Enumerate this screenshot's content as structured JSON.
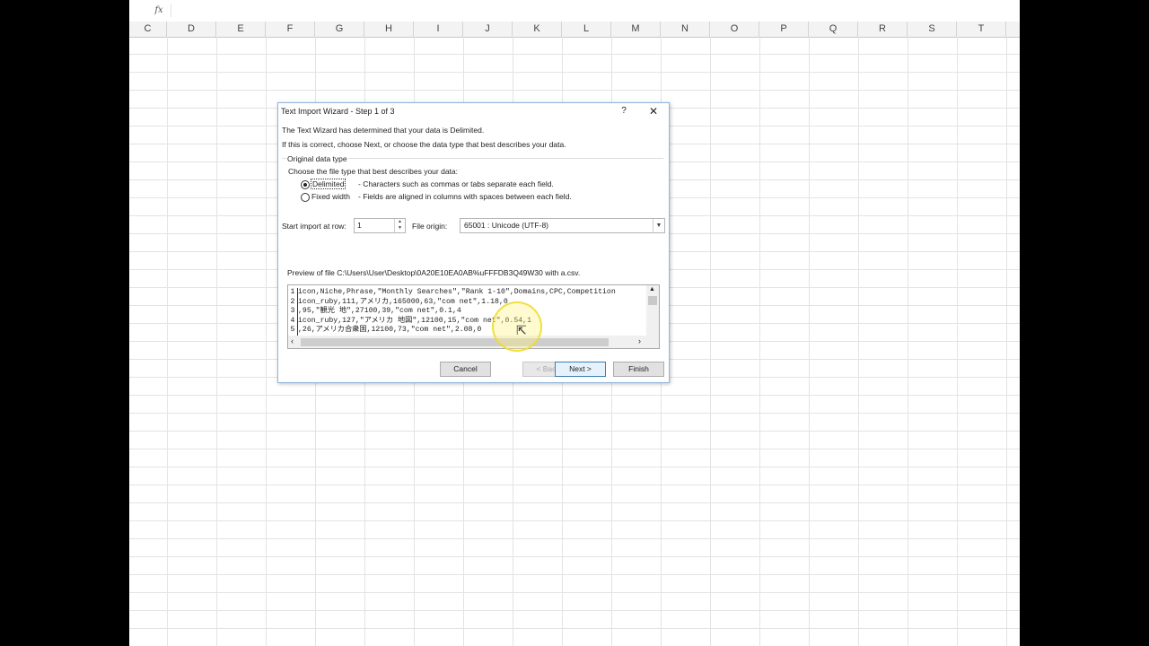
{
  "excel": {
    "formula_symbol": "fx",
    "columns": [
      "C",
      "D",
      "E",
      "F",
      "G",
      "H",
      "I",
      "J",
      "K",
      "L",
      "M",
      "N",
      "O",
      "P",
      "Q",
      "R",
      "S",
      "T"
    ]
  },
  "dialog": {
    "title": "Text Import Wizard - Step 1 of 3",
    "help_label": "?",
    "close_label": "✕",
    "intro_line1": "The Text Wizard has determined that your data is Delimited.",
    "intro_line2": "If this is correct, choose Next, or choose the data type that best describes your data.",
    "group_label": "Original data type",
    "group_prompt": "Choose the file type that best describes your data:",
    "options": [
      {
        "label": "Delimited",
        "description": "- Characters such as commas or tabs separate each field.",
        "selected": true
      },
      {
        "label": "Fixed width",
        "description": "- Fields are aligned in columns with spaces between each field.",
        "selected": false
      }
    ],
    "start_row_label": "Start import at row:",
    "start_row_value": "1",
    "file_origin_label": "File origin:",
    "file_origin_value": "65001 : Unicode (UTF-8)",
    "preview_label": "Preview of file C:\\Users\\User\\Desktop\\0A20E10EA0AB%uFFFDB3Q49W30 with a.csv.",
    "preview_lines": [
      {
        "num": "1",
        "text": "icon,Niche,Phrase,\"Monthly Searches\",\"Rank 1-10\",Domains,CPC,Competition"
      },
      {
        "num": "2",
        "text": "icon_ruby,111,アメリカ,165000,63,\"com net\",1.18,0"
      },
      {
        "num": "3",
        "text": ",95,\"観光 地\",27100,39,\"com net\",0.1,4"
      },
      {
        "num": "4",
        "text": "icon_ruby,127,\"アメリカ 地図\",12100,15,\"com net\",0.54,1"
      },
      {
        "num": "5",
        "text": ",26,アメリカ合衆国,12100,73,\"com net\",2.08,0"
      }
    ],
    "buttons": {
      "cancel": "Cancel",
      "back": "< Back",
      "next": "Next >",
      "finish": "Finish"
    }
  }
}
